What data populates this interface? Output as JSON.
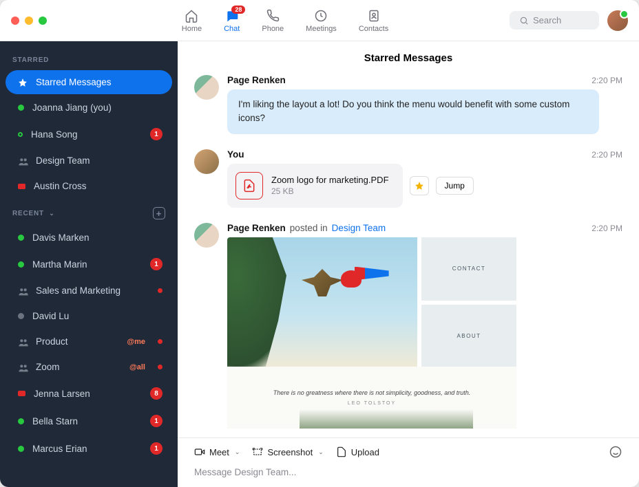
{
  "topnav": {
    "items": [
      {
        "label": "Home",
        "icon": "home-icon"
      },
      {
        "label": "Chat",
        "icon": "chat-icon",
        "badge": "28",
        "active": true
      },
      {
        "label": "Phone",
        "icon": "phone-icon"
      },
      {
        "label": "Meetings",
        "icon": "clock-icon"
      },
      {
        "label": "Contacts",
        "icon": "contacts-icon"
      }
    ],
    "search_placeholder": "Search"
  },
  "sidebar": {
    "starred_heading": "STARRED",
    "recent_heading": "RECENT",
    "starred": [
      {
        "label": "Starred Messages",
        "type": "star",
        "active": true
      },
      {
        "label": "Joanna Jiang (you)",
        "type": "online"
      },
      {
        "label": "Hana Song",
        "type": "away",
        "unread": "1"
      },
      {
        "label": "Design Team",
        "type": "group"
      },
      {
        "label": "Austin Cross",
        "type": "dnd"
      }
    ],
    "recent": [
      {
        "label": "Davis Marken",
        "type": "online"
      },
      {
        "label": "Martha Marin",
        "type": "online",
        "unread": "1"
      },
      {
        "label": "Sales and Marketing",
        "type": "group",
        "dot": true
      },
      {
        "label": "David Lu",
        "type": "offline"
      },
      {
        "label": "Product",
        "type": "group",
        "mention": "@me",
        "dot": true
      },
      {
        "label": "Zoom",
        "type": "group",
        "mention": "@all",
        "dot": true
      },
      {
        "label": "Jenna Larsen",
        "type": "dnd",
        "unread": "8"
      },
      {
        "label": "Bella Starn",
        "type": "online",
        "unread": "1"
      },
      {
        "label": "Marcus Erian",
        "type": "online",
        "unread": "1"
      }
    ]
  },
  "chat": {
    "title": "Starred Messages",
    "messages": [
      {
        "sender": "Page Renken",
        "time": "2:20 PM",
        "bubble": "I'm liking the layout a lot! Do you think the menu would benefit with some custom icons?"
      },
      {
        "sender": "You",
        "time": "2:20 PM",
        "file": {
          "name": "Zoom logo for marketing.PDF",
          "size": "25 KB"
        },
        "jump": "Jump"
      },
      {
        "sender": "Page Renken",
        "posted": " posted in ",
        "channel": "Design Team",
        "time": "2:20 PM",
        "preview": {
          "tiles": [
            "CONTACT",
            "ABOUT"
          ],
          "quote": "There is no greatness where there is not simplicity, goodness, and truth.",
          "author": "LEO TOLSTOY"
        }
      }
    ]
  },
  "composer": {
    "meet": "Meet",
    "screenshot": "Screenshot",
    "upload": "Upload",
    "placeholder": "Message Design Team..."
  }
}
